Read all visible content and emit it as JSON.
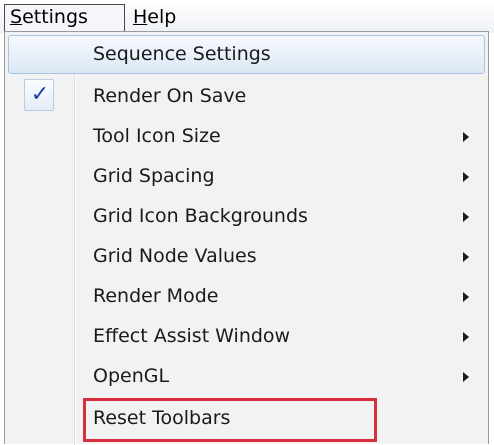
{
  "menubar": {
    "settings": {
      "hotkey": "S",
      "rest": "ettings"
    },
    "help": {
      "hotkey": "H",
      "rest": "elp"
    }
  },
  "settings_menu": {
    "items": [
      {
        "label": "Sequence Settings",
        "checked": false,
        "submenu": false,
        "highlighted": true
      },
      {
        "label": "Render On Save",
        "checked": true,
        "submenu": false
      },
      {
        "label": "Tool Icon Size",
        "checked": false,
        "submenu": true
      },
      {
        "label": "Grid Spacing",
        "checked": false,
        "submenu": true
      },
      {
        "label": "Grid Icon Backgrounds",
        "checked": false,
        "submenu": true
      },
      {
        "label": "Grid Node Values",
        "checked": false,
        "submenu": true
      },
      {
        "label": "Render Mode",
        "checked": false,
        "submenu": true
      },
      {
        "label": "Effect Assist Window",
        "checked": false,
        "submenu": true
      },
      {
        "label": "OpenGL",
        "checked": false,
        "submenu": true
      },
      {
        "label": "Reset Toolbars",
        "checked": false,
        "submenu": false,
        "annotated": true
      }
    ],
    "check_glyph": "✓"
  },
  "colors": {
    "highlight_bg": "#dce8f6",
    "check": "#1f3fa8",
    "annotation_box": "#d42e3c"
  },
  "icons": {
    "check": "check-icon",
    "submenu": "submenu-arrow-icon"
  }
}
